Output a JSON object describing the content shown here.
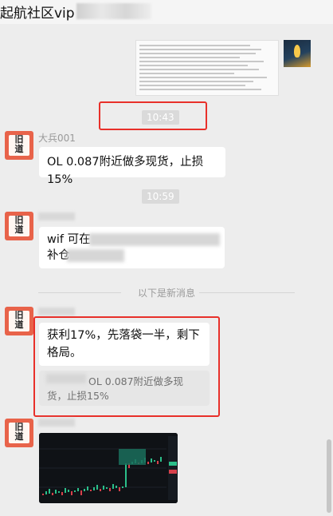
{
  "window": {
    "title": "起航社区vip"
  },
  "preview_card": {
    "lines": 12
  },
  "messages": [
    {
      "timestamp": "10:43",
      "sender": "大兵001",
      "text": "OL 0.087附近做多现货，止损15%"
    },
    {
      "timestamp": "10:59",
      "text_start": "wif 可在",
      "text_line2": "补仓"
    },
    {
      "divider_text": "以下是新消息",
      "text": "获利17%，先落袋一半，剩下格局。",
      "quote": "OL 0.087附近做多现货，止损15%"
    }
  ],
  "chart_image": {
    "type": "candlestick",
    "theme": "dark"
  },
  "colors": {
    "highlight": "#e8302a",
    "avatar": "#e8634a",
    "background": "#ededed"
  }
}
